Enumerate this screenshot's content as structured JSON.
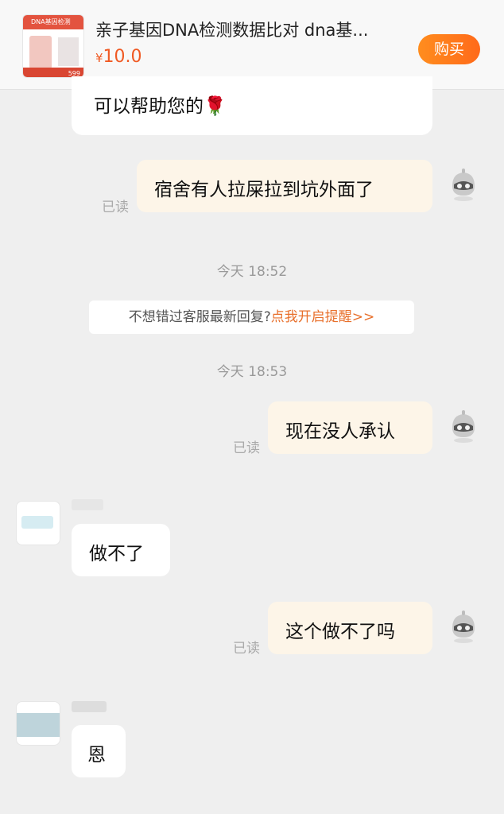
{
  "header": {
    "product_title": "亲子基因DNA检测数据比对 dna基...",
    "currency": "¥",
    "price": "10.0",
    "buy_label": "购买",
    "thumb_band_text": "DNA基因检测",
    "thumb_badge": "599"
  },
  "messages": [
    {
      "side": "left",
      "text": "可以帮助您的🌹"
    },
    {
      "side": "right",
      "text": "宿舍有人拉屎拉到坑外面了",
      "status": "已读"
    },
    {
      "side": "right",
      "text": "现在没人承认",
      "status": "已读"
    },
    {
      "side": "left",
      "text": "做不了"
    },
    {
      "side": "right",
      "text": "这个做不了吗",
      "status": "已读"
    },
    {
      "side": "left",
      "text": "恩"
    }
  ],
  "timestamps": [
    "今天 18:52",
    "今天 18:53"
  ],
  "notice": {
    "text": "不想错过客服最新回复?",
    "link": "点我开启提醒>>"
  },
  "colors": {
    "accent": "#ff6a1a",
    "price": "#f05a24",
    "link": "#e8702c",
    "my_bubble": "#fdf5e8",
    "background": "#efefef"
  }
}
